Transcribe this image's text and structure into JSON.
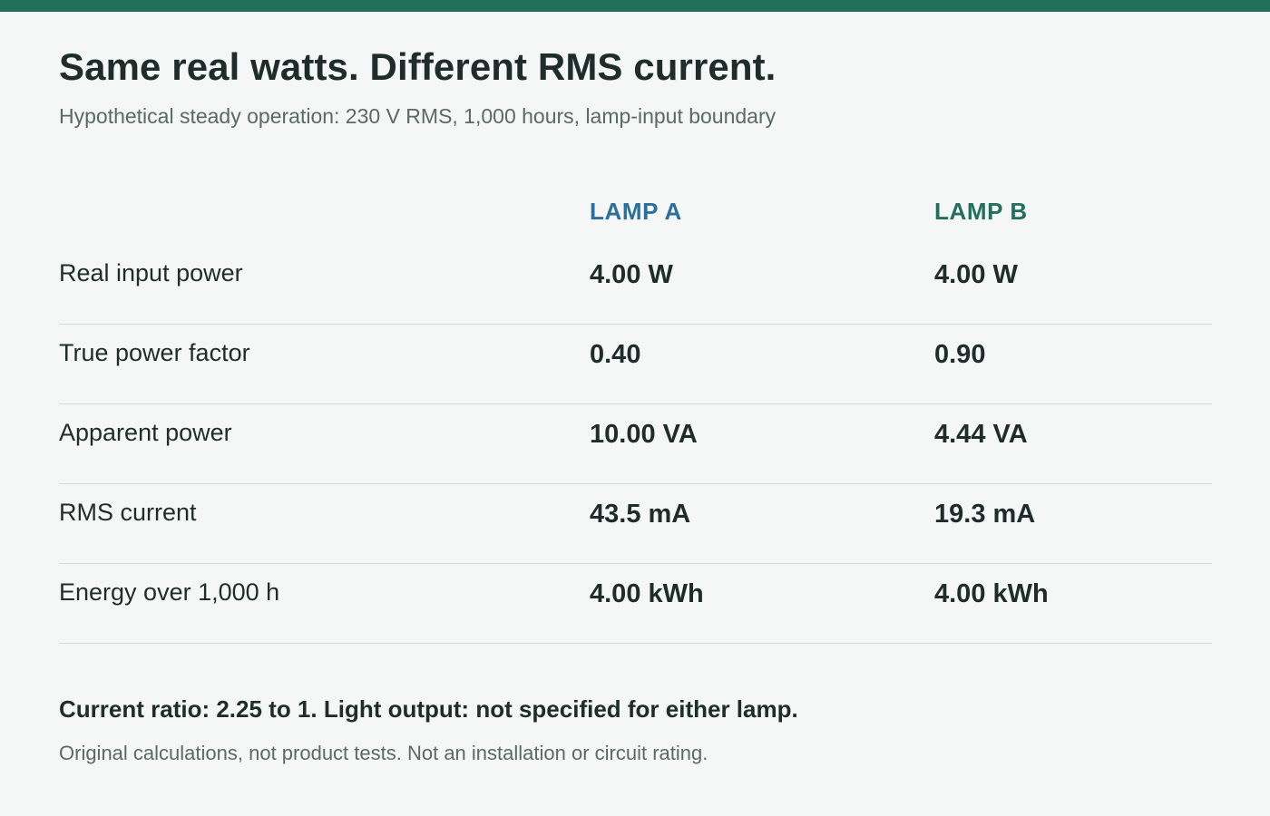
{
  "page": {
    "title": "Same real watts. Different RMS current.",
    "subtitle": "Hypothetical steady operation: 230 V RMS, 1,000 hours, lamp-input boundary"
  },
  "table": {
    "columns": [
      "LAMP A",
      "LAMP B"
    ],
    "rows": [
      {
        "label": "Real input power",
        "lamp_a": "4.00 W",
        "lamp_b": "4.00 W"
      },
      {
        "label": "True power factor",
        "lamp_a": "0.40",
        "lamp_b": "0.90"
      },
      {
        "label": "Apparent power",
        "lamp_a": "10.00 VA",
        "lamp_b": "4.44 VA"
      },
      {
        "label": "RMS current",
        "lamp_a": "43.5 mA",
        "lamp_b": "19.3 mA"
      },
      {
        "label": "Energy over 1,000 h",
        "lamp_a": "4.00 kWh",
        "lamp_b": "4.00 kWh"
      }
    ]
  },
  "footer": {
    "summary": "Current ratio: 2.25 to 1. Light output: not specified for either lamp.",
    "disclaimer": "Original calculations, not product tests. Not an installation or circuit rating."
  },
  "colors": {
    "accent_bar": "#23705a",
    "lamp_a": "#2d6f9b",
    "lamp_b": "#23705a",
    "background": "#f4f7f6"
  }
}
